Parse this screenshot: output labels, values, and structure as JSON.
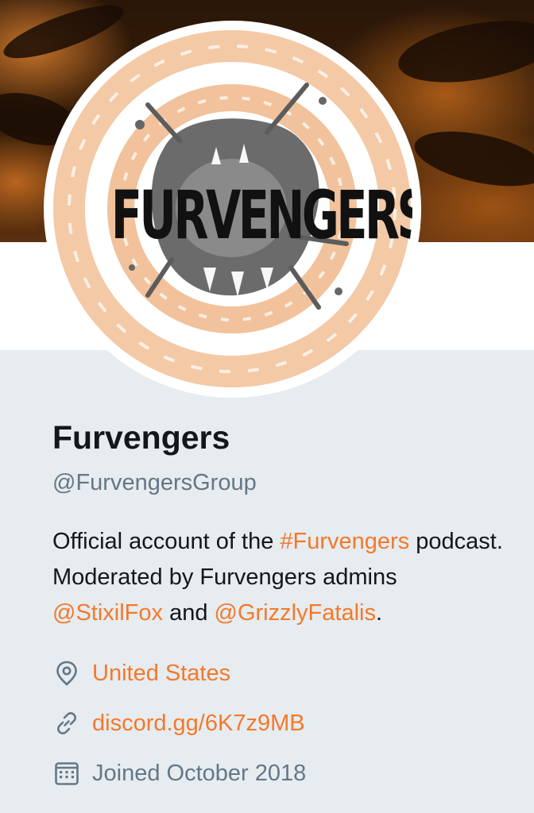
{
  "profile": {
    "name": "Furvengers",
    "handle": "@FurvengersGroup",
    "avatar_logo_text": "FURVENGERS",
    "bio": {
      "part1": "Official account of the ",
      "hashtag": "#Furvengers",
      "part2": " podcast. Moderated by Furvengers admins ",
      "mention1": "@StixilFox",
      "part3": " and ",
      "mention2": "@GrizzlyFatalis",
      "part4": "."
    },
    "location": "United States",
    "website": "discord.gg/6K7z9MB",
    "joined": "Joined October 2018"
  },
  "icons": {
    "location": "location-pin-icon",
    "link": "link-icon",
    "calendar": "calendar-icon"
  },
  "colors": {
    "accent": "#f4792a",
    "secondary_text": "#657786",
    "primary_text": "#14171a",
    "background": "#e6ecf0"
  }
}
